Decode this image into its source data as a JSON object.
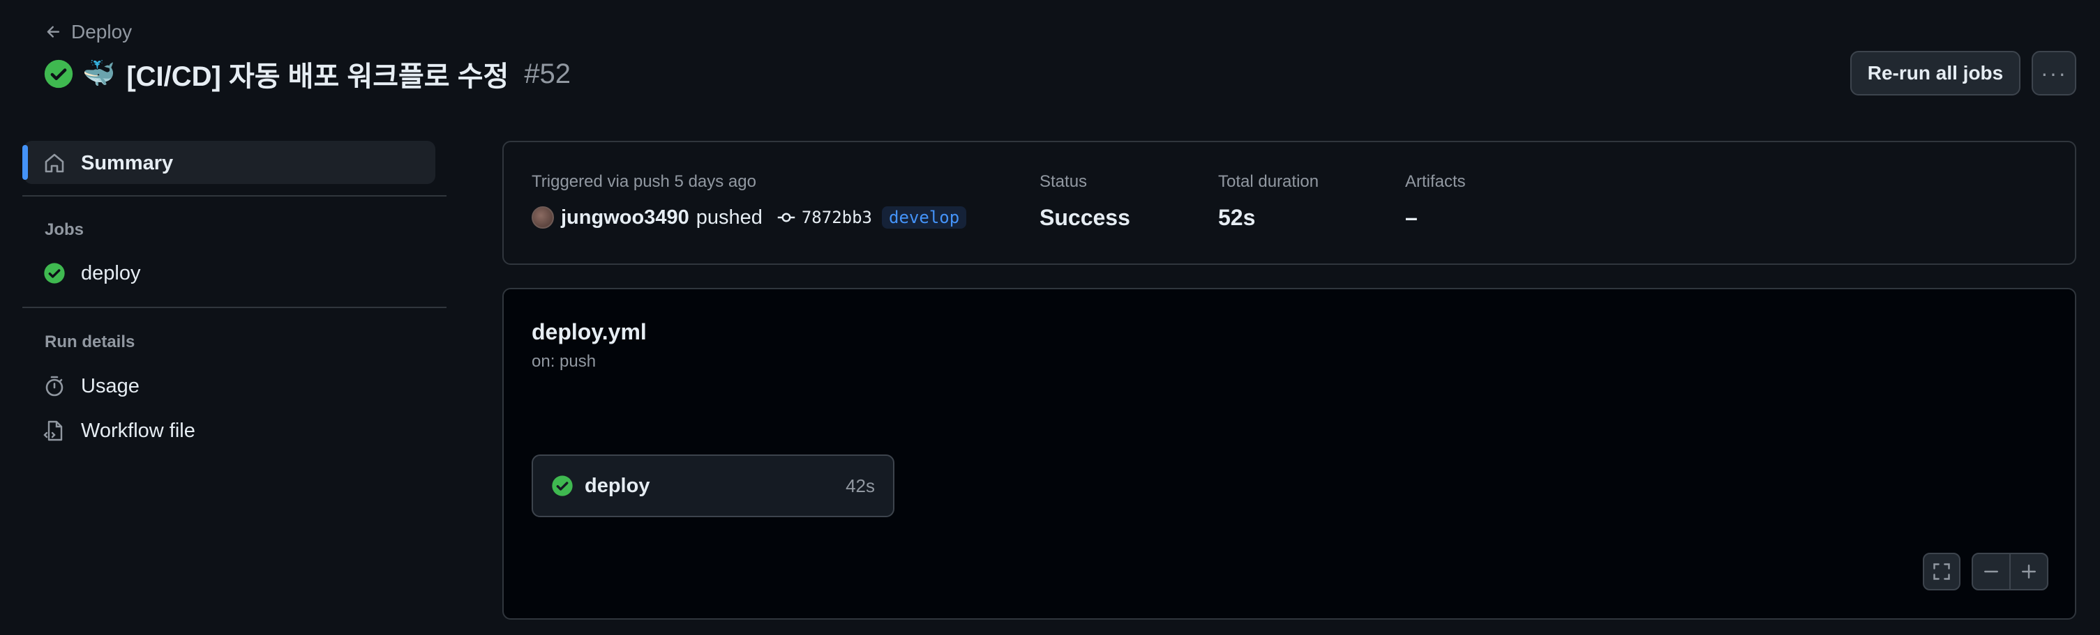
{
  "header": {
    "back_label": "Deploy",
    "title_emoji": "🐳",
    "title": "[CI/CD] 자동 배포 워크플로 수정",
    "run_number": "#52",
    "rerun_label": "Re-run all jobs",
    "more_label": "···"
  },
  "sidebar": {
    "summary_label": "Summary",
    "jobs_heading": "Jobs",
    "jobs": [
      {
        "label": "deploy",
        "status": "success"
      }
    ],
    "run_details_heading": "Run details",
    "usage_label": "Usage",
    "workflow_file_label": "Workflow file"
  },
  "summary": {
    "trigger_text": "Triggered via push 5 days ago",
    "user": "jungwoo3490",
    "action": "pushed",
    "commit": "7872bb3",
    "branch": "develop",
    "status_label": "Status",
    "status_value": "Success",
    "duration_label": "Total duration",
    "duration_value": "52s",
    "artifacts_label": "Artifacts",
    "artifacts_value": "–"
  },
  "graph": {
    "workflow_name": "deploy.yml",
    "trigger": "on: push",
    "job": {
      "name": "deploy",
      "duration": "42s"
    }
  },
  "colors": {
    "background": "#0d1117",
    "success": "#3fb950",
    "accent": "#4493f8"
  },
  "icons": [
    "arrow-left-icon",
    "check-circle-icon",
    "home-icon",
    "stopwatch-icon",
    "file-code-icon",
    "git-commit-icon",
    "screen-full-icon",
    "minus-icon",
    "plus-icon"
  ]
}
